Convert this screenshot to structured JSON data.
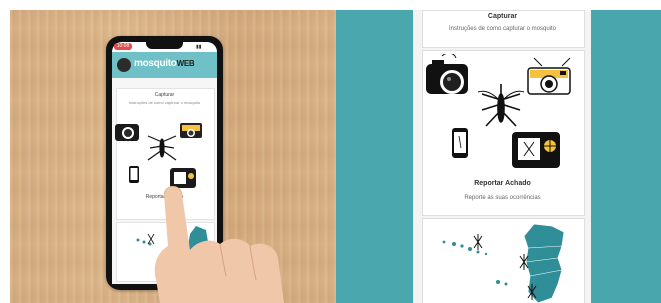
{
  "phone": {
    "status_time": "10:08",
    "app_name": "mosquito",
    "app_name_suffix": "WEB",
    "capture_title": "Capturar",
    "capture_subtitle": "Instruções de como capturar o mosquito",
    "report_title": "Reportar Achado"
  },
  "page": {
    "capture_title": "Capturar",
    "capture_subtitle": "Instruções de como capturar o mosquito",
    "report_title": "Reportar Achado",
    "report_subtitle": "Reporte as suas ocorrências"
  },
  "colors": {
    "wood": "#dcb487",
    "teal": "#4aa7ae",
    "app_header": "#6fc0c7",
    "status_red": "#e14a4a",
    "camera_yellow": "#f6c23e",
    "map_teal": "#2f8e97",
    "skin": "#f0c7a8"
  },
  "icons": {
    "logo": "mosquito-logo-icon",
    "camera_dslr": "camera-icon",
    "camera_polaroid": "polaroid-camera-icon",
    "mosquito": "mosquito-icon",
    "smartphone": "smartphone-icon",
    "camera_screen": "camera-screen-icon",
    "map": "portugal-map-icon"
  }
}
